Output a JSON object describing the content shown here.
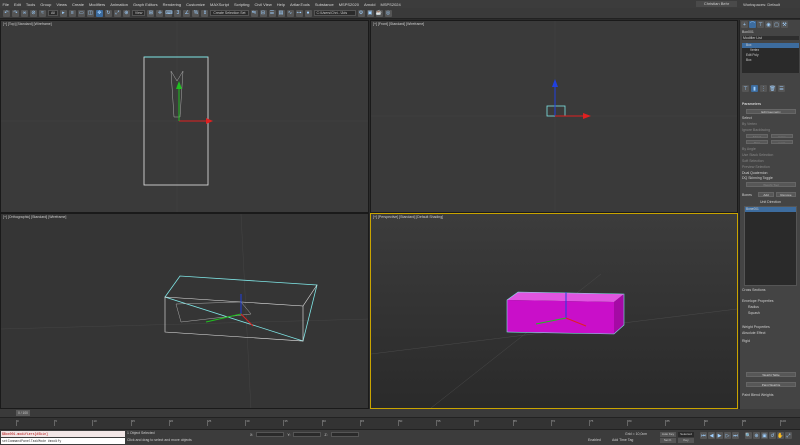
{
  "menubar": {
    "items": [
      "File",
      "Edit",
      "Tools",
      "Group",
      "Views",
      "Create",
      "Modifiers",
      "Animation",
      "Graph Editors",
      "Rendering",
      "Customize",
      "MAXScript",
      "Scripting",
      "Civil View",
      "Help",
      "ArtlanTools",
      "Substance",
      "MSPS2020",
      "Arnold",
      "MSPS2024"
    ],
    "user": "Christian Behr",
    "workspace": "Workspaces: Default"
  },
  "toolbar": {
    "selection_filter": "All",
    "named_sets": "Create Selection Set",
    "path_field": "C:\\Users\\Chri...\\3ds Max 2024"
  },
  "viewports": {
    "top": "[+] [Top] [Standard] [Wireframe]",
    "front": "[+] [Front] [Standard] [Wireframe]",
    "ortho": "[+] [Orthographic] [Standard] [Wireframe]",
    "persp": "[+] [Perspective] [Standard] [Default Shading]"
  },
  "command_panel": {
    "object_name": "Box001",
    "modifier_list": "Modifier List",
    "stack": [
      "Box",
      "Vertex",
      "Edit Poly",
      "Box"
    ],
    "rollout_title": "Parameters",
    "edit_geometry": "Edit Geometry",
    "select_label": "Select",
    "by_vertex": "By Vertex",
    "ignore_backfacing": "Ignore Backfacing",
    "by_angle": "By Angle",
    "shrink": "Shrink",
    "grow": "Grow",
    "ring": "Ring",
    "loop": "Loop",
    "preview_selection": "Preview Selection",
    "off": "Off",
    "subobj": "SubObj",
    "multi": "Multi",
    "soft_selection": "Soft Selection",
    "edit_vertices": "Edit Vertices",
    "use_stack_selection": "Use Stack Selection",
    "dq_skinning_toggle": "DQ Skinning Toggle",
    "dual_quaternion": "Dual Quaternion",
    "weight_tool": "Weight Tool",
    "bones": "Bones",
    "add": "Add",
    "remove": "Remove",
    "list_header": "Unit Direction",
    "list_items": [
      "Bone001"
    ],
    "cross_sections": "Cross Sections",
    "envelope_properties": "Envelope Properties",
    "radius": "Radius",
    "squash": "Squash",
    "weight_properties": "Weight Properties",
    "absolute_effect": "Absolute Effect",
    "rigid": "Rigid",
    "weight_table": "Weight Table",
    "paint_weights": "Paint Weights",
    "paint_blend_weights": "Paint Blend Weights"
  },
  "timeline": {
    "frame_display": "0 / 100",
    "ticks": [
      "0",
      "5",
      "10",
      "15",
      "20",
      "25",
      "30",
      "35",
      "40",
      "45",
      "50",
      "55",
      "60",
      "65",
      "70",
      "75",
      "80",
      "85",
      "90",
      "95",
      "100"
    ]
  },
  "status": {
    "script_line1": "$Box001.modifiers[#Skin]",
    "script_line2": "setCommandPanelTaskMode #modify",
    "selected": "1 Object Selected",
    "prompt": "Click and drag to select and move objects",
    "x_label": "X:",
    "y_label": "Y:",
    "z_label": "Z:",
    "grid": "Grid = 10,0cm",
    "add_time_tag": "Add Time Tag",
    "enabled": "Enabled",
    "auto_key": "Auto Key",
    "selected_mode": "Selected",
    "set_key": "Set K.",
    "key_filters": "Key Filters..."
  },
  "colors": {
    "wire_cyan": "#7fe6e6",
    "box_magenta": "#c90fc9",
    "active_border": "#c9a400",
    "accent_blue": "#3d6c9e"
  }
}
